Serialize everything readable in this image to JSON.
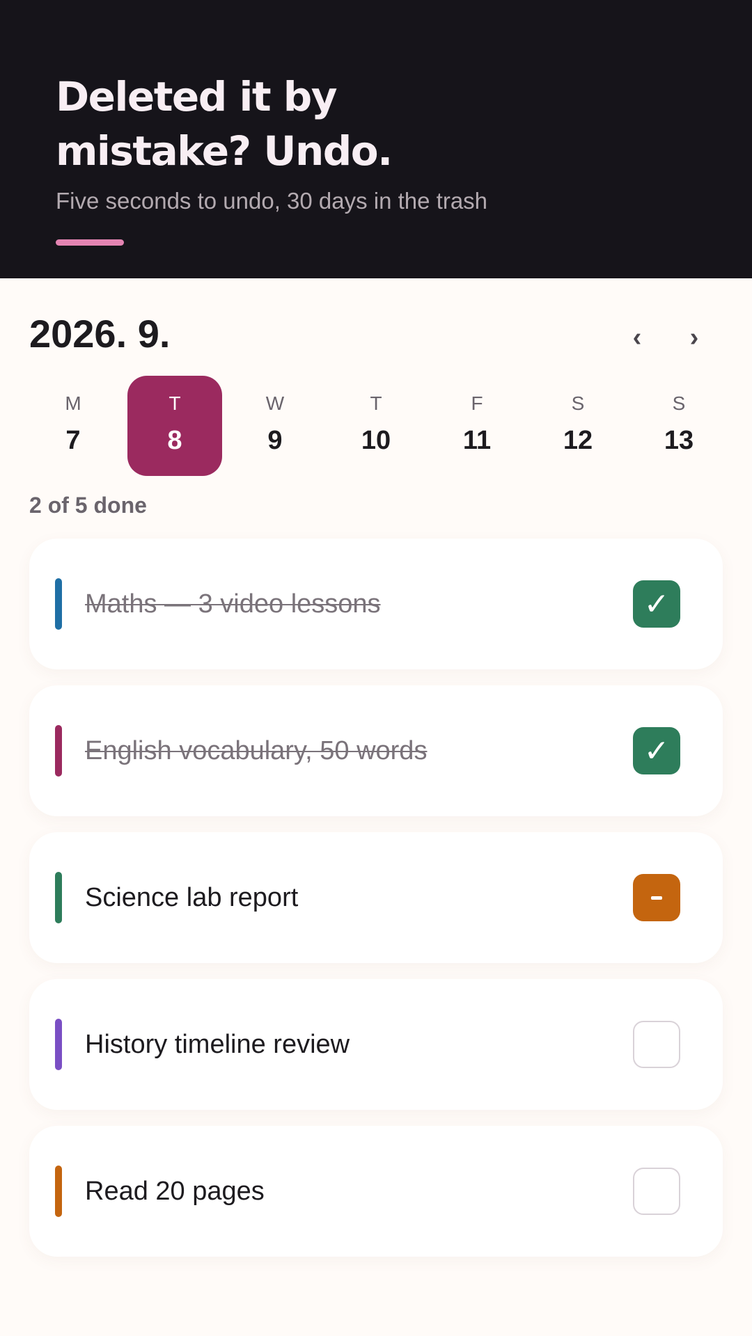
{
  "hero": {
    "title_line1": "Deleted it by",
    "title_line2": "mistake? Undo.",
    "subtitle": "Five seconds to undo, 30 days in the trash",
    "accent_color": "#e484b2"
  },
  "calendar": {
    "month_label": "2026. 9.",
    "prev_icon": "chevron-left-icon",
    "next_icon": "chevron-right-icon",
    "prev_glyph": "‹",
    "next_glyph": "›",
    "selected_color": "#9b2a5f",
    "days": [
      {
        "dow": "M",
        "num": "7"
      },
      {
        "dow": "T",
        "num": "8",
        "selected": true
      },
      {
        "dow": "W",
        "num": "9"
      },
      {
        "dow": "T",
        "num": "10"
      },
      {
        "dow": "F",
        "num": "11"
      },
      {
        "dow": "S",
        "num": "12"
      },
      {
        "dow": "S",
        "num": "13"
      }
    ]
  },
  "progress": {
    "text": "2 of 5 done",
    "done": 2,
    "total": 5
  },
  "tasks": [
    {
      "label": "Maths — 3 video lessons",
      "color": "#1f6fa5",
      "status": "done",
      "check_icon": "check-icon",
      "check_glyph": "✓"
    },
    {
      "label": "English vocabulary, 50 words",
      "color": "#9b2a5f",
      "status": "done",
      "check_icon": "check-icon",
      "check_glyph": "✓"
    },
    {
      "label": "Science lab report",
      "color": "#2e7d5b",
      "status": "partial",
      "check_icon": "dash-icon"
    },
    {
      "label": "History timeline review",
      "color": "#7a4fc4",
      "status": "todo"
    },
    {
      "label": "Read 20 pages",
      "color": "#c4650f",
      "status": "todo"
    }
  ],
  "status_colors": {
    "done": "#2e7d5b",
    "partial": "#c4650f",
    "todo_border": "#d9d2d8"
  }
}
